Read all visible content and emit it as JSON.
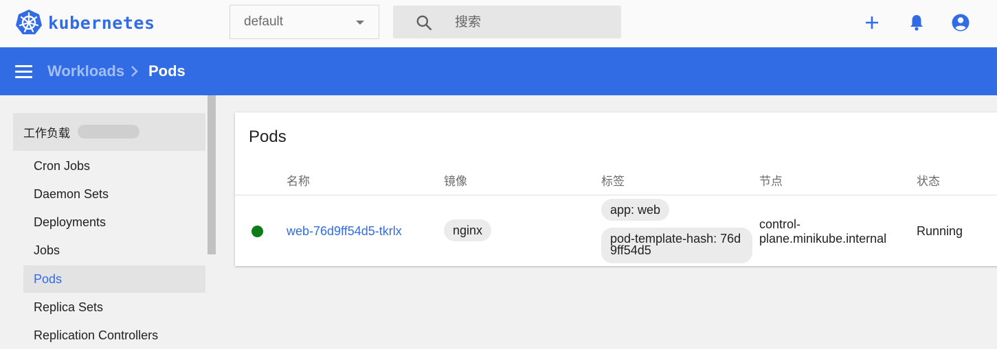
{
  "topbar": {
    "logo_text": "kubernetes",
    "namespace": "default",
    "search_placeholder": "搜索"
  },
  "breadcrumb": {
    "parent": "Workloads",
    "current": "Pods"
  },
  "sidebar": {
    "group_label": "工作负载",
    "items": [
      {
        "label": "Cron Jobs"
      },
      {
        "label": "Daemon Sets"
      },
      {
        "label": "Deployments"
      },
      {
        "label": "Jobs"
      },
      {
        "label": "Pods"
      },
      {
        "label": "Replica Sets"
      },
      {
        "label": "Replication Controllers"
      }
    ],
    "active_item": "Pods"
  },
  "card": {
    "title": "Pods",
    "columns": [
      "名称",
      "镜像",
      "标签",
      "节点",
      "状态"
    ],
    "rows": [
      {
        "name": "web-76d9ff54d5-tkrlx",
        "image": "nginx",
        "labels": [
          "app: web",
          "pod-template-hash: 76d9ff54d5"
        ],
        "node": "control-plane.minikube.internal",
        "status": "Running",
        "status_color": "#0b7d14"
      }
    ]
  },
  "colors": {
    "brand": "#326ce5",
    "status_running": "#0b7d14"
  },
  "icons": {
    "logo": "kubernetes-logo-icon",
    "search": "search-icon",
    "add": "plus-icon",
    "notifications": "bell-icon",
    "account": "account-circle-icon",
    "menu": "hamburger-menu-icon",
    "breadcrumb_separator": "chevron-right-icon",
    "dropdown": "caret-down-icon"
  }
}
